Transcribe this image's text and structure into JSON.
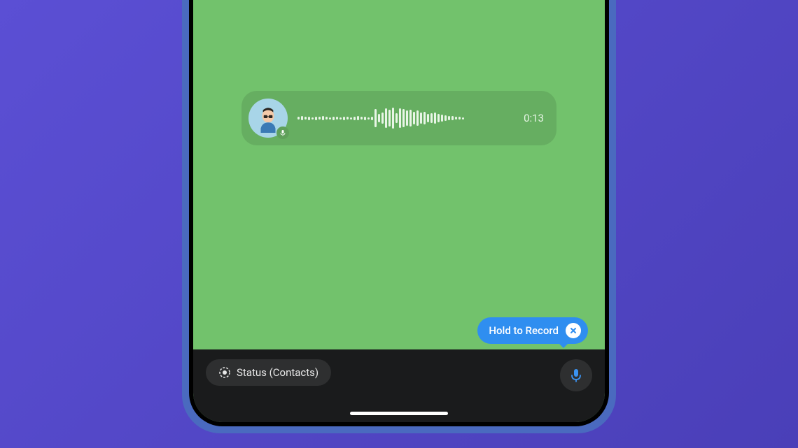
{
  "voiceMessage": {
    "duration": "0:13",
    "waveHeights": [
      4,
      6,
      4,
      5,
      3,
      5,
      4,
      6,
      4,
      3,
      5,
      4,
      3,
      5,
      4,
      3,
      5,
      6,
      4,
      5,
      3,
      5,
      26,
      12,
      16,
      28,
      24,
      30,
      14,
      28,
      26,
      22,
      24,
      18,
      22,
      16,
      18,
      12,
      14,
      16,
      12,
      10,
      8,
      6,
      6,
      4,
      4,
      3
    ]
  },
  "tooltip": {
    "label": "Hold to Record"
  },
  "bottomBar": {
    "statusLabel": "Status (Contacts)"
  },
  "colors": {
    "background": "#5b4fd4",
    "chatBg": "#72c26c",
    "accent": "#2f8ef0",
    "barBg": "#1a1b1c"
  }
}
